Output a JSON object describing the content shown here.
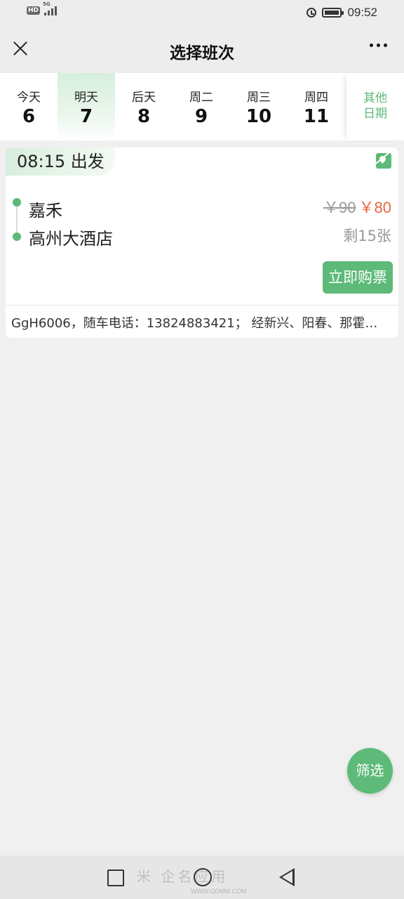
{
  "status_bar": {
    "hd": "HD",
    "network": "5G",
    "time": "09:52"
  },
  "header": {
    "title": "选择班次",
    "close_icon": "close-icon",
    "more_icon": "more-icon"
  },
  "dates": [
    {
      "label": "今天",
      "num": "6",
      "active": false
    },
    {
      "label": "明天",
      "num": "7",
      "active": true
    },
    {
      "label": "后天",
      "num": "8",
      "active": false
    },
    {
      "label": "周二",
      "num": "9",
      "active": false
    },
    {
      "label": "周三",
      "num": "10",
      "active": false
    },
    {
      "label": "周四",
      "num": "11",
      "active": false
    }
  ],
  "other_date": {
    "line1": "其他",
    "line2": "日期"
  },
  "trip": {
    "depart": "08:15 出发",
    "from": "嘉禾",
    "to": "高州大酒店",
    "old_price": "￥90",
    "new_price": "￥80",
    "remaining": "剩15张",
    "buy_label": "立即购票",
    "description": "GgH6006，随车电话：13824883421； 经新兴、阳春、那霍…"
  },
  "filter_label": "筛选",
  "watermark": {
    "text": "米 企名应用",
    "url": "WWW.GDMM.COM"
  },
  "colors": {
    "accent": "#5dba78",
    "price": "#e8663d",
    "background": "#f0f0f0"
  }
}
